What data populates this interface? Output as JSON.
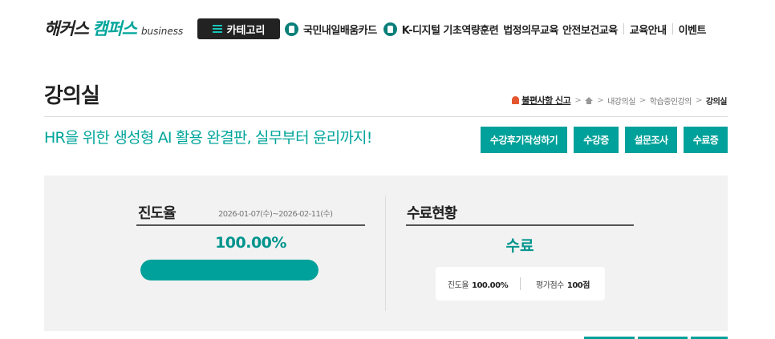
{
  "header": {
    "logo": {
      "part1": "해커스",
      "part2": "캠퍼스",
      "part3": "business"
    },
    "category_label": "카테고리",
    "nav": [
      "국민내일배움카드",
      "K-디지털 기초역량훈련",
      "법정의무교육",
      "안전보건교육",
      "교육안내",
      "이벤트"
    ]
  },
  "page": {
    "title": "강의실",
    "breadcrumb": {
      "report": "불편사항 신고",
      "items": [
        "내강의실",
        "학습중인강의"
      ],
      "current": "강의실"
    },
    "course_title": "HR을 위한 생성형 AI 활용 완결판, 실무부터 윤리까지!",
    "buttons": [
      "수강후기작성하기",
      "수강증",
      "설문조사",
      "수료증"
    ]
  },
  "progress": {
    "title": "진도율",
    "period": "2026-01-07(수)~2026-02-11(수)",
    "percent_text": "100.00%",
    "percent_value": 100
  },
  "completion": {
    "title": "수료현황",
    "status": "수료",
    "progress_label": "진도율",
    "progress_value": "100.00%",
    "score_label": "평가점수",
    "score_value": "100점"
  },
  "colors": {
    "accent": "#00a19a",
    "dark": "#222222"
  }
}
